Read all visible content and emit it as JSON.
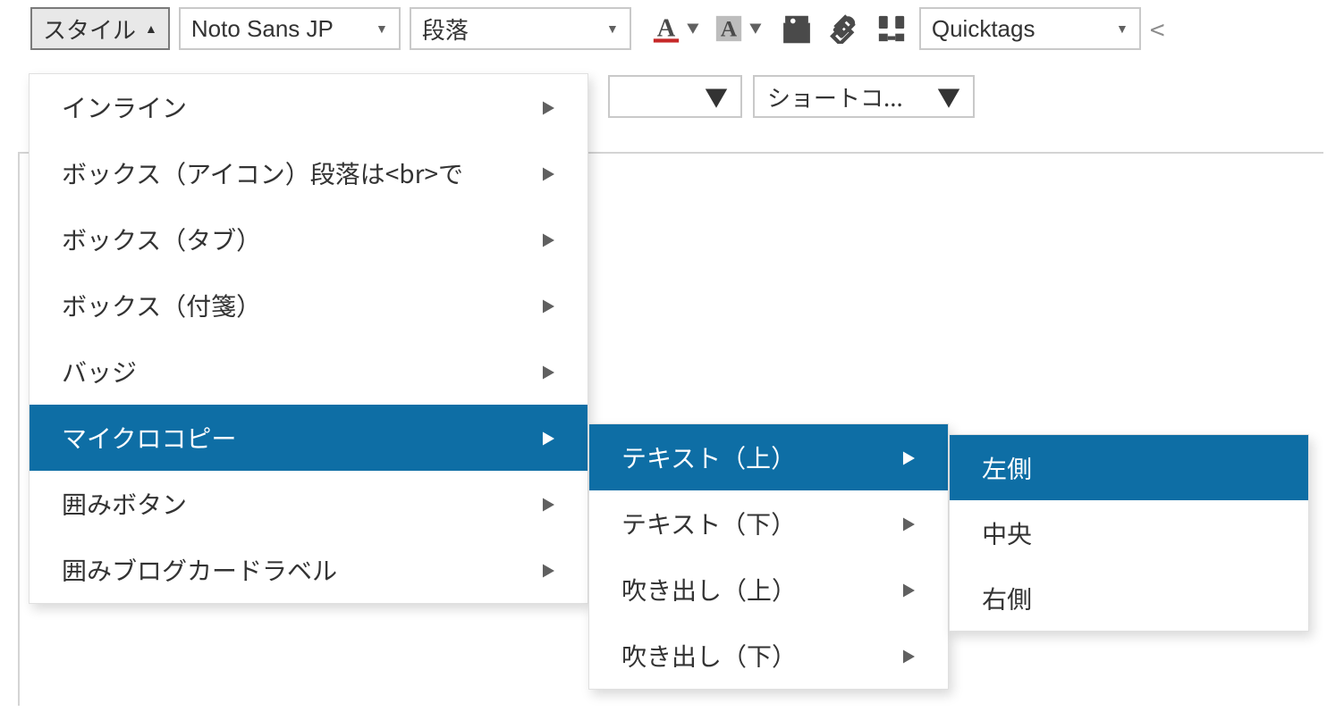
{
  "toolbar": {
    "style_btn": "スタイル",
    "font_family": "Noto Sans JP",
    "block_format": "段落",
    "quicktags": "Quicktags"
  },
  "row2": {
    "unknown_dd_caret": "▼",
    "shortcode_dd": "ショートコ..."
  },
  "menu1": [
    {
      "label": "インライン",
      "has_sub": true
    },
    {
      "label": "ボックス（アイコン）段落は<br>で",
      "has_sub": true
    },
    {
      "label": "ボックス（タブ）",
      "has_sub": true
    },
    {
      "label": "ボックス（付箋）",
      "has_sub": true
    },
    {
      "label": "バッジ",
      "has_sub": true
    },
    {
      "label": "マイクロコピー",
      "has_sub": true,
      "hl": true
    },
    {
      "label": "囲みボタン",
      "has_sub": true
    },
    {
      "label": "囲みブログカードラベル",
      "has_sub": true
    }
  ],
  "menu2": [
    {
      "label": "テキスト（上）",
      "has_sub": true,
      "hl": true
    },
    {
      "label": "テキスト（下）",
      "has_sub": true
    },
    {
      "label": "吹き出し（上）",
      "has_sub": true
    },
    {
      "label": "吹き出し（下）",
      "has_sub": true
    }
  ],
  "menu3": [
    {
      "label": "左側",
      "hl": true
    },
    {
      "label": "中央"
    },
    {
      "label": "右側"
    }
  ],
  "icons": {
    "text_color": "text-color-icon",
    "bg_color": "bg-color-icon",
    "template": "template-icon",
    "eraser": "eraser-icon",
    "find_replace": "find-replace-icon",
    "less_than": "<"
  }
}
